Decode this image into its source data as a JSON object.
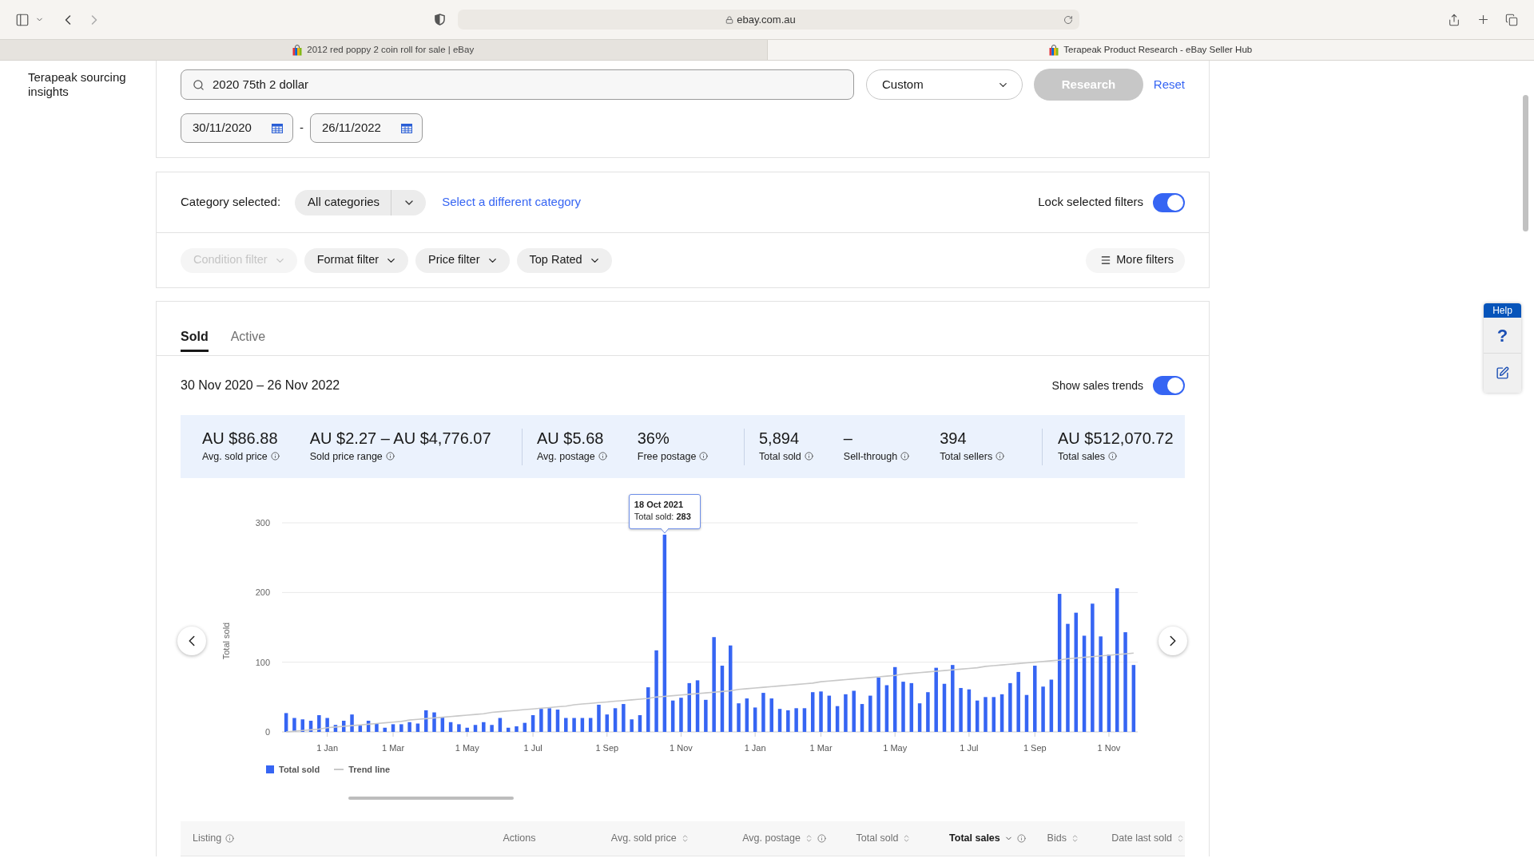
{
  "browser": {
    "url": "ebay.com.au",
    "tabs": [
      {
        "title": "2012 red poppy 2 coin roll for sale | eBay",
        "selected": false
      },
      {
        "title": "Terapeak Product Research - eBay Seller Hub",
        "selected": true
      }
    ]
  },
  "sidebar": {
    "title": "Terapeak sourcing insights"
  },
  "search": {
    "query": "2020 75th 2 dollar",
    "range": "Custom",
    "research_button": {
      "label": "Research",
      "disabled": true
    },
    "reset": "Reset",
    "date_from": "30/11/2020",
    "date_separator": "-",
    "date_to": "26/11/2022"
  },
  "category": {
    "label": "Category selected:",
    "value": "All categories",
    "change_link": "Select a different category",
    "lock": {
      "label": "Lock selected filters",
      "on": true
    }
  },
  "filters": [
    {
      "label": "Condition filter",
      "disabled": true
    },
    {
      "label": "Format filter",
      "disabled": false
    },
    {
      "label": "Price filter",
      "disabled": false
    },
    {
      "label": "Top Rated",
      "disabled": false
    }
  ],
  "more_filters": {
    "label": "More filters"
  },
  "results": {
    "tabs": [
      {
        "label": "Sold",
        "selected": true
      },
      {
        "label": "Active",
        "selected": false
      }
    ],
    "date_range": "30 Nov 2020 – 26 Nov 2022",
    "trends": {
      "label": "Show sales trends",
      "on": true
    },
    "stat_groups": [
      [
        {
          "value": "AU $86.88",
          "label": "Avg. sold price",
          "info": true
        },
        {
          "value": "AU $2.27 – AU $4,776.07",
          "label": "Sold price range",
          "info": true
        }
      ],
      [
        {
          "value": "AU $5.68",
          "label": "Avg. postage",
          "info": true
        },
        {
          "value": "36%",
          "label": "Free postage",
          "info": true
        }
      ],
      [
        {
          "value": "5,894",
          "label": "Total sold",
          "info": true
        },
        {
          "value": "–",
          "label": "Sell-through",
          "info": true
        },
        {
          "value": "394",
          "label": "Total sellers",
          "info": true
        }
      ],
      [
        {
          "value": "AU $512,070.72",
          "label": "Total sales",
          "info": true
        }
      ]
    ],
    "chart_data": {
      "type": "bar",
      "ylabel": "Total sold",
      "categories": [
        null,
        null,
        null,
        null,
        null,
        "1 Jan",
        null,
        null,
        null,
        null,
        null,
        null,
        null,
        "1 Mar",
        null,
        null,
        null,
        null,
        null,
        null,
        null,
        null,
        "1 May",
        null,
        null,
        null,
        null,
        null,
        null,
        null,
        "1 Jul",
        null,
        null,
        null,
        null,
        null,
        null,
        null,
        null,
        "1 Sep",
        null,
        null,
        null,
        null,
        null,
        null,
        null,
        null,
        "1 Nov",
        null,
        null,
        null,
        null,
        null,
        null,
        null,
        null,
        "1 Jan",
        null,
        null,
        null,
        null,
        null,
        null,
        null,
        "1 Mar",
        null,
        null,
        null,
        null,
        null,
        null,
        null,
        null,
        "1 May",
        null,
        null,
        null,
        null,
        null,
        null,
        null,
        null,
        "1 Jul",
        null,
        null,
        null,
        null,
        null,
        null,
        null,
        "1 Sep",
        null,
        null,
        null,
        null,
        null,
        null,
        null,
        null,
        "1 Nov",
        null,
        null,
        null
      ],
      "series": [
        {
          "name": "Total sold",
          "color": "#3665f3",
          "values": [
            27,
            20,
            18,
            16,
            24,
            20,
            10,
            16,
            25,
            9,
            16,
            12,
            6,
            11,
            11,
            14,
            12,
            31,
            28,
            21,
            14,
            11,
            6,
            10,
            14,
            10,
            20,
            6,
            8,
            13,
            24,
            33,
            34,
            32,
            20,
            20,
            20,
            20,
            39,
            25,
            34,
            40,
            18,
            24,
            64,
            117,
            283,
            45,
            49,
            70,
            74,
            46,
            136,
            95,
            124,
            41,
            48,
            35,
            56,
            48,
            33,
            31,
            34,
            34,
            57,
            58,
            52,
            37,
            54,
            59,
            40,
            52,
            78,
            67,
            93,
            72,
            70,
            41,
            57,
            92,
            69,
            96,
            63,
            61,
            45,
            50,
            50,
            54,
            70,
            86,
            53,
            95,
            65,
            75,
            198,
            155,
            171,
            138,
            184,
            137,
            111,
            206,
            143,
            96
          ]
        },
        {
          "name": "Trend line",
          "type": "line",
          "color": "#c8c8c8",
          "values": [
            0,
            1,
            2,
            3,
            4,
            6,
            7,
            8,
            9,
            10,
            11,
            12,
            13,
            14,
            15,
            17,
            18,
            19,
            20,
            21,
            22,
            23,
            24,
            25,
            26,
            28,
            29,
            30,
            31,
            32,
            33,
            34,
            35,
            36,
            37,
            39,
            40,
            41,
            42,
            43,
            44,
            45,
            46,
            47,
            48,
            50,
            51,
            52,
            53,
            54,
            55,
            56,
            57,
            58,
            59,
            61,
            62,
            63,
            64,
            65,
            66,
            67,
            68,
            69,
            70,
            72,
            73,
            74,
            75,
            76,
            77,
            78,
            79,
            80,
            81,
            83,
            84,
            85,
            86,
            87,
            88,
            89,
            90,
            91,
            92,
            94,
            95,
            96,
            97,
            98,
            99,
            100,
            101,
            102,
            103,
            105,
            106,
            107,
            108,
            109,
            110,
            111,
            112,
            113
          ]
        }
      ],
      "ylim": [
        0,
        300
      ],
      "yticks": [
        0,
        100,
        200,
        300
      ],
      "legend": "bottom",
      "annotations": [
        "18 Oct 2021",
        "Total sold: **283**"
      ]
    },
    "table": {
      "columns": [
        {
          "label": "Listing",
          "info": true,
          "sortable": false,
          "sorted": false
        },
        {
          "label": "Actions",
          "info": false,
          "sortable": false,
          "sorted": false
        },
        {
          "label": "Avg. sold price",
          "info": false,
          "sortable": true,
          "sorted": false
        },
        {
          "label": "Avg. postage",
          "info": true,
          "sortable": true,
          "sorted": false
        },
        {
          "label": "Total sold",
          "info": false,
          "sortable": true,
          "sorted": false
        },
        {
          "label": "Total sales",
          "info": true,
          "sortable": true,
          "sorted": true
        },
        {
          "label": "Bids",
          "info": false,
          "sortable": true,
          "sorted": false
        },
        {
          "label": "Date last sold",
          "info": false,
          "sortable": true,
          "sorted": false
        }
      ]
    }
  },
  "help": {
    "label": "Help",
    "question": "?"
  }
}
